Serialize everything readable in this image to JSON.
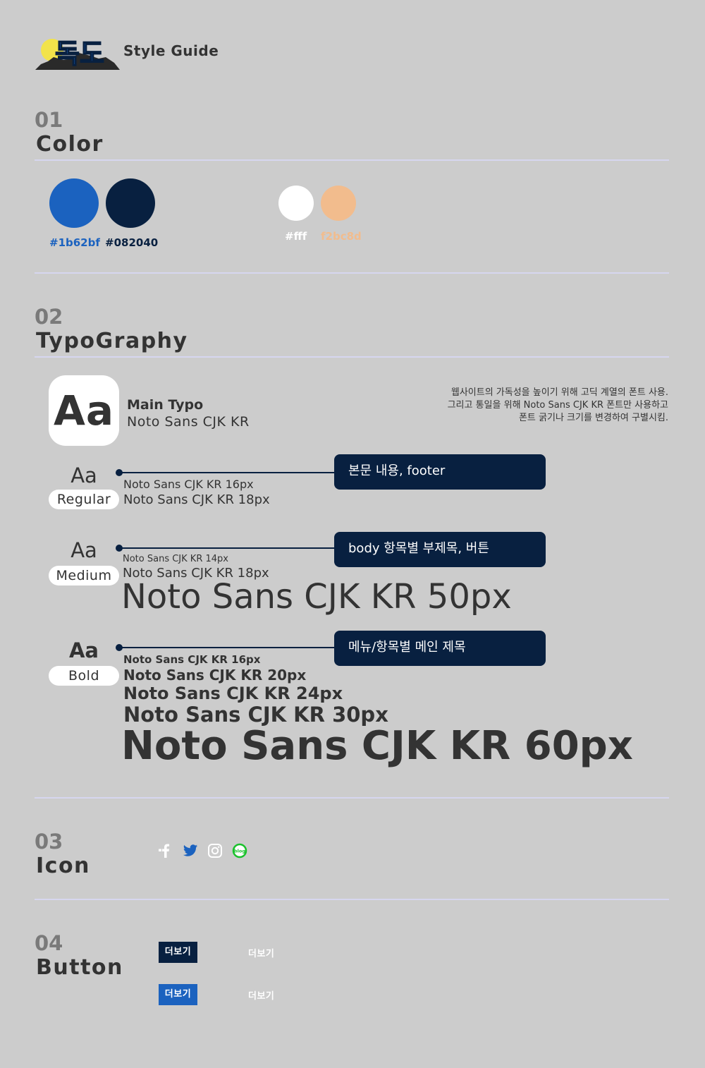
{
  "header": {
    "logo_text": "독도",
    "title": "Style Guide"
  },
  "sections": {
    "color": {
      "number": "01",
      "title": "Color"
    },
    "typography": {
      "number": "02",
      "title": "TypoGraphy"
    },
    "icon": {
      "number": "03",
      "title": "Icon"
    },
    "button": {
      "number": "04",
      "title": "Button"
    }
  },
  "colors": [
    {
      "hex": "#1b62bf",
      "label": "#1b62bf",
      "label_color": "#1b62bf"
    },
    {
      "hex": "#082040",
      "label": "#082040",
      "label_color": "#082040"
    },
    {
      "hex": "#ffffff",
      "label": "#fff",
      "label_color": "#ffffff"
    },
    {
      "hex": "#f2bc8d",
      "label": "f2bc8d",
      "label_color": "#f2bc8d"
    }
  ],
  "typography": {
    "sample_glyph": "Aa",
    "main_label": "Main Typo",
    "main_font": "Noto Sans CJK KR",
    "description": [
      "웹사이트의 가독성을 높이기 위해 고딕 계열의 폰트 사용.",
      "그리고 통일을 위해 Noto Sans CJK KR 폰트만 사용하고",
      "폰트 굵기나 크기를 변경하여 구별시킴."
    ],
    "weights": [
      {
        "glyph": "Aa",
        "name": "Regular",
        "usage": "본문 내용, footer",
        "samples": [
          "Noto Sans CJK KR 16px",
          "Noto Sans CJK KR 18px"
        ]
      },
      {
        "glyph": "Aa",
        "name": "Medium",
        "usage": "body 항목별 부제목, 버튼",
        "samples": [
          "Noto Sans CJK KR 14px",
          "Noto Sans CJK KR 18px",
          "Noto Sans CJK KR 50px"
        ]
      },
      {
        "glyph": "Aa",
        "name": "Bold",
        "usage": "메뉴/항목별 메인 제목",
        "samples": [
          "Noto Sans CJK KR 16px",
          "Noto Sans CJK KR 20px",
          "Noto Sans CJK KR 24px",
          "Noto Sans CJK KR 30px",
          "Noto Sans CJK KR 60px"
        ]
      }
    ]
  },
  "icons": [
    {
      "name": "facebook-icon",
      "color": "#ffffff"
    },
    {
      "name": "twitter-icon",
      "color": "#1b62bf"
    },
    {
      "name": "instagram-icon",
      "color": "#ffffff"
    },
    {
      "name": "blog-icon",
      "color": "#19c12b",
      "text": "blog"
    }
  ],
  "buttons": [
    {
      "label": "더보기",
      "style": "filled",
      "bg": "#082040"
    },
    {
      "label": "더보기",
      "style": "ghost"
    },
    {
      "label": "더보기",
      "style": "filled",
      "bg": "#1b62bf"
    },
    {
      "label": "더보기",
      "style": "ghost"
    }
  ]
}
